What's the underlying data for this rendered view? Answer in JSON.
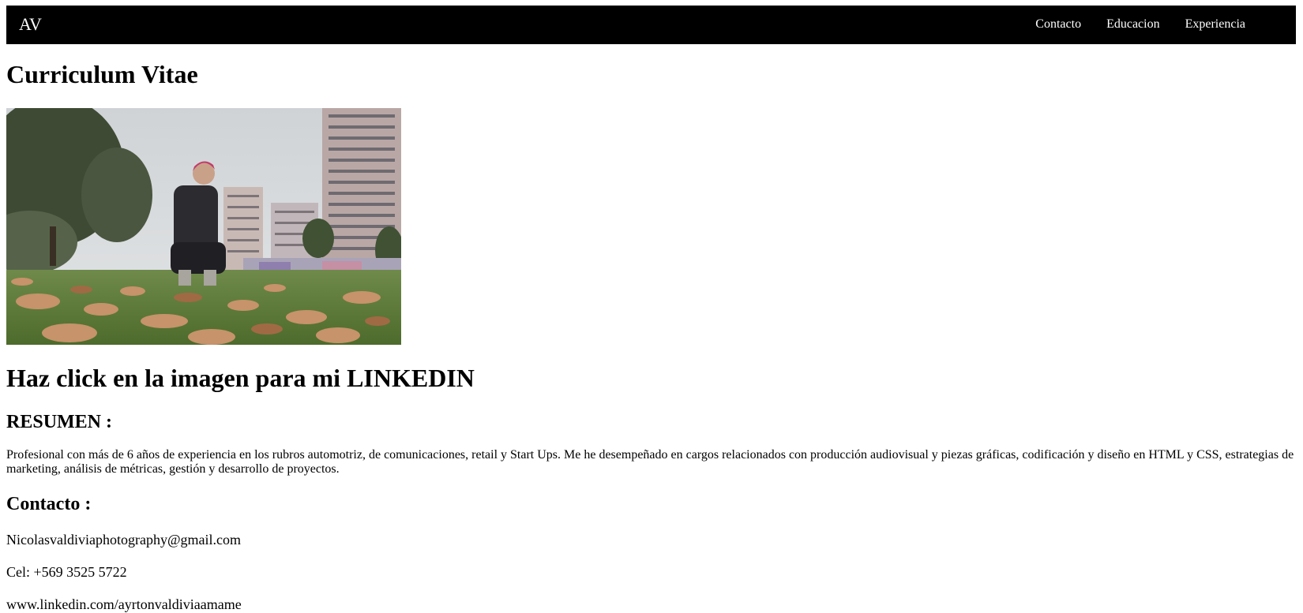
{
  "nav": {
    "brand": "AV",
    "links": [
      "Contacto",
      "Educacion",
      "Experiencia"
    ]
  },
  "main": {
    "title": "Curriculum Vitae",
    "photo_alt": "Foto de perfil",
    "linkedin_cta": "Haz click en la imagen para mi LINKEDIN",
    "resumen_title": "RESUMEN :",
    "resumen_text": "Profesional con más de 6 años de experiencia en los rubros automotriz, de comunicaciones, retail y Start Ups. Me he desempeñado en cargos relacionados con producción audiovisual y piezas gráficas, codificación y diseño en HTML y CSS, estrategias de marketing, análisis de métricas, gestión y desarrollo de proyectos.",
    "contacto_title": "Contacto :",
    "email": "Nicolasvaldiviaphotography@gmail.com",
    "phone": "Cel: +569 3525 5722",
    "linkedin_url": "www.linkedin.com/ayrtonvaldiviaamame"
  },
  "colors": {
    "navbar_bg": "#000000",
    "navbar_text": "#ffffff",
    "page_bg": "#ffffff"
  }
}
